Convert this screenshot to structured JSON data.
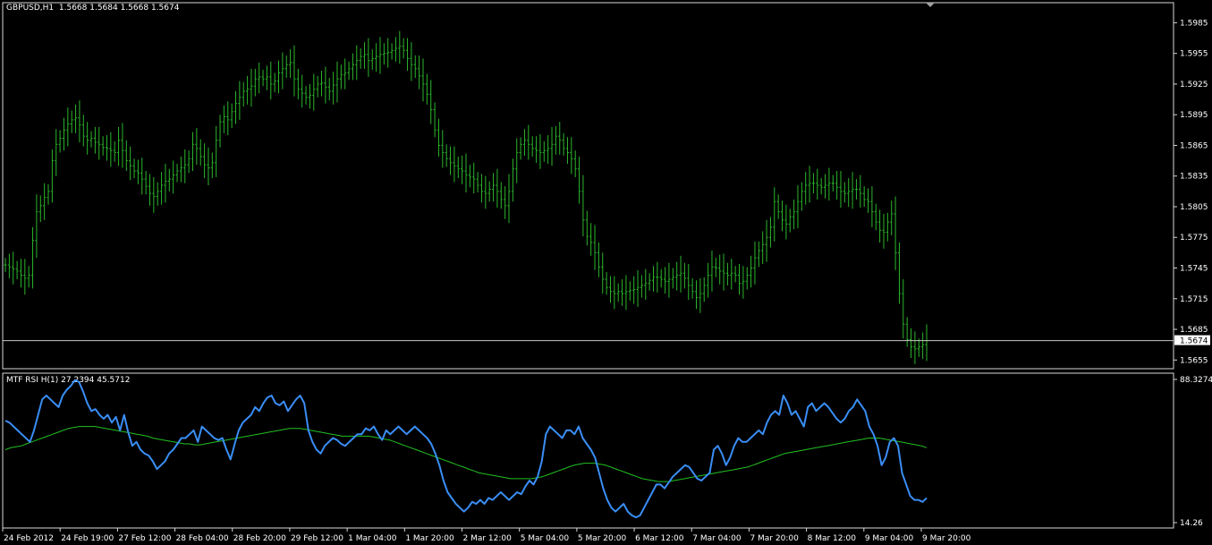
{
  "header": {
    "main_label": "GBPUSD,H1  1.5668 1.5684 1.5668 1.5674",
    "sub_label": "MTF RSI H(1) 27.2394 45.5712"
  },
  "colors": {
    "background": "#000000",
    "bars": "#2bb52b",
    "rsi": "#3a8ef5",
    "rsi_ma": "#22c022",
    "frame": "#d8d8d8"
  },
  "chart_data": [
    {
      "type": "bar",
      "title": "GBPUSD,H1",
      "ohlc_label": "1.5668 1.5684 1.5668 1.5674",
      "y_ticks": [
        "1.5985",
        "1.5955",
        "1.5925",
        "1.5895",
        "1.5865",
        "1.5835",
        "1.5805",
        "1.5775",
        "1.5745",
        "1.5715",
        "1.5685",
        "1.5655"
      ],
      "ylim": [
        1.565,
        1.5995
      ],
      "current_price": "1.5674",
      "x_ticks": [
        "24 Feb 2012",
        "24 Feb 19:00",
        "27 Feb 12:00",
        "28 Feb 04:00",
        "28 Feb 20:00",
        "29 Feb 12:00",
        "1 Mar 04:00",
        "1 Mar 20:00",
        "2 Mar 12:00",
        "5 Mar 04:00",
        "5 Mar 20:00",
        "6 Mar 12:00",
        "7 Mar 04:00",
        "7 Mar 20:00",
        "8 Mar 12:00",
        "9 Mar 04:00",
        "9 Mar 20:00"
      ],
      "close": [
        1.5748,
        1.5746,
        1.5744,
        1.5742,
        1.5738,
        1.5735,
        1.5738,
        1.5772,
        1.58,
        1.5806,
        1.5814,
        1.582,
        1.585,
        1.5866,
        1.5872,
        1.588,
        1.5886,
        1.589,
        1.5892,
        1.5885,
        1.5874,
        1.587,
        1.5872,
        1.5868,
        1.5866,
        1.5863,
        1.5862,
        1.586,
        1.5858,
        1.587,
        1.586,
        1.585,
        1.5845,
        1.584,
        1.5838,
        1.5832,
        1.5825,
        1.5818,
        1.5815,
        1.582,
        1.5826,
        1.583,
        1.5832,
        1.5836,
        1.584,
        1.5843,
        1.5846,
        1.5852,
        1.5866,
        1.5862,
        1.5854,
        1.5846,
        1.5843,
        1.5848,
        1.587,
        1.5888,
        1.5893,
        1.589,
        1.5898,
        1.5906,
        1.5912,
        1.5918,
        1.592,
        1.5923,
        1.593,
        1.5932,
        1.593,
        1.5932,
        1.5925,
        1.5928,
        1.5936,
        1.594,
        1.5944,
        1.5946,
        1.593,
        1.592,
        1.5916,
        1.5912,
        1.5914,
        1.592,
        1.5925,
        1.5926,
        1.5922,
        1.5918,
        1.5924,
        1.593,
        1.5934,
        1.5936,
        1.594,
        1.5944,
        1.5948,
        1.5952,
        1.5954,
        1.5948,
        1.595,
        1.5952,
        1.5954,
        1.5955,
        1.5956,
        1.5958,
        1.596,
        1.5962,
        1.5958,
        1.595,
        1.5944,
        1.594,
        1.5933,
        1.5925,
        1.5915,
        1.59,
        1.588,
        1.5865,
        1.5858,
        1.5852,
        1.5848,
        1.5845,
        1.5842,
        1.584,
        1.5836,
        1.5834,
        1.5832,
        1.5826,
        1.582,
        1.5818,
        1.5822,
        1.5826,
        1.582,
        1.5812,
        1.5806,
        1.582,
        1.5842,
        1.5858,
        1.5866,
        1.587,
        1.5866,
        1.5862,
        1.586,
        1.5858,
        1.586,
        1.5862,
        1.5866,
        1.5874,
        1.587,
        1.5862,
        1.5858,
        1.5852,
        1.5842,
        1.582,
        1.5792,
        1.5776,
        1.577,
        1.576,
        1.5746,
        1.5734,
        1.5726,
        1.5722,
        1.572,
        1.5722,
        1.572,
        1.5722,
        1.5723,
        1.5724,
        1.5726,
        1.5728,
        1.573,
        1.5733,
        1.5736,
        1.5736,
        1.5734,
        1.5732,
        1.5734,
        1.5736,
        1.5738,
        1.574,
        1.5735,
        1.5728,
        1.5722,
        1.5716,
        1.572,
        1.5728,
        1.5738,
        1.5746,
        1.5745,
        1.5742,
        1.574,
        1.5738,
        1.574,
        1.5738,
        1.573,
        1.5732,
        1.5738,
        1.5745,
        1.5755,
        1.5762,
        1.5768,
        1.5775,
        1.5785,
        1.581,
        1.58,
        1.5792,
        1.5788,
        1.5795,
        1.58,
        1.581,
        1.582,
        1.5826,
        1.5828,
        1.5828,
        1.5826,
        1.5824,
        1.5826,
        1.5828,
        1.5828,
        1.5824,
        1.582,
        1.5818,
        1.582,
        1.5822,
        1.5822,
        1.5818,
        1.5812,
        1.581,
        1.58,
        1.579,
        1.5782,
        1.578,
        1.579,
        1.5798,
        1.576,
        1.572,
        1.569,
        1.5675,
        1.5668,
        1.5666,
        1.5668,
        1.567,
        1.5674
      ],
      "series": [
        {
          "name": "MTF RSI H(1)",
          "last_value": "27.2394"
        },
        {
          "last_value": "45.5712"
        }
      ],
      "rsi_ylim": [
        14.26,
        88.3274
      ],
      "rsi_ticks": [
        "88.3274",
        "14.26"
      ],
      "rsi": [
        67,
        66,
        64,
        62,
        60,
        58,
        56,
        62,
        70,
        78,
        80,
        78,
        76,
        74,
        80,
        83,
        85,
        88,
        87,
        82,
        76,
        72,
        73,
        70,
        68,
        70,
        66,
        69,
        62,
        70,
        61,
        54,
        56,
        52,
        50,
        49,
        46,
        42,
        44,
        46,
        50,
        52,
        55,
        58,
        58,
        60,
        62,
        56,
        64,
        62,
        60,
        58,
        57,
        58,
        52,
        47,
        55,
        62,
        66,
        68,
        70,
        74,
        72,
        76,
        79,
        80,
        76,
        75,
        77,
        72,
        75,
        78,
        80,
        76,
        62,
        56,
        52,
        50,
        54,
        56,
        58,
        57,
        55,
        54,
        56,
        58,
        60,
        60,
        63,
        62,
        64,
        60,
        57,
        62,
        60,
        62,
        64,
        62,
        60,
        62,
        64,
        62,
        60,
        58,
        55,
        50,
        44,
        36,
        30,
        27,
        24,
        22,
        20,
        22,
        25,
        24,
        26,
        24,
        27,
        26,
        28,
        30,
        28,
        26,
        28,
        30,
        29,
        33,
        36,
        34,
        38,
        46,
        60,
        64,
        62,
        60,
        58,
        62,
        62,
        60,
        64,
        58,
        55,
        52,
        48,
        40,
        32,
        26,
        22,
        20,
        22,
        24,
        20,
        18,
        17,
        18,
        22,
        26,
        30,
        34,
        34,
        32,
        35,
        38,
        40,
        42,
        44,
        43,
        40,
        37,
        36,
        38,
        40,
        52,
        54,
        50,
        44,
        48,
        54,
        58,
        56,
        56,
        58,
        60,
        62,
        60,
        66,
        70,
        72,
        70,
        80,
        76,
        70,
        72,
        68,
        64,
        74,
        76,
        72,
        74,
        76,
        74,
        71,
        68,
        66,
        68,
        72,
        74,
        78,
        75,
        72,
        64,
        60,
        54,
        44,
        48,
        56,
        58,
        54,
        40,
        34,
        28,
        26,
        26,
        25,
        27
      ],
      "rsi_ma": [
        52,
        53,
        53.5,
        54,
        55,
        56,
        57,
        58,
        59,
        60,
        61,
        62,
        63,
        63.5,
        64,
        64,
        64,
        64,
        63.5,
        63,
        62.5,
        62,
        61.5,
        61,
        60.5,
        60,
        59.5,
        59,
        58,
        57.5,
        57,
        56.5,
        56,
        55.5,
        55,
        55,
        54.5,
        54.5,
        55,
        55.5,
        56,
        56.5,
        57,
        57.5,
        58,
        58.5,
        59,
        59.5,
        60,
        60.5,
        61,
        61.5,
        62,
        62.5,
        63,
        63,
        63,
        62.5,
        62,
        61.5,
        61,
        60.5,
        60,
        59.5,
        59,
        59,
        59,
        59,
        59,
        59,
        58.5,
        58,
        57.5,
        57,
        56,
        55,
        54,
        53,
        52,
        51,
        50,
        49,
        48,
        47,
        46,
        45,
        44,
        43,
        42,
        41,
        40,
        39.5,
        39,
        38.5,
        38,
        37.5,
        37,
        37,
        37,
        37,
        37,
        37.5,
        38,
        39,
        40,
        41,
        42,
        43,
        44,
        44.5,
        45,
        45,
        45,
        44.5,
        44,
        43,
        42,
        41,
        40,
        39,
        38,
        37,
        36.5,
        36,
        35.5,
        35.5,
        35.5,
        36,
        36.5,
        37,
        37.5,
        38,
        38.5,
        39,
        39.5,
        40,
        40.5,
        41,
        41.5,
        42,
        42.5,
        43,
        44,
        45,
        46,
        47,
        48,
        49,
        50,
        50.5,
        51,
        51.5,
        52,
        52.5,
        53,
        53.5,
        54,
        54.5,
        55,
        55.5,
        56,
        56.5,
        57,
        57.5,
        58,
        58,
        58,
        57.5,
        57,
        56.5,
        56,
        55.5,
        55,
        54.5,
        54,
        53
      ]
    }
  ]
}
